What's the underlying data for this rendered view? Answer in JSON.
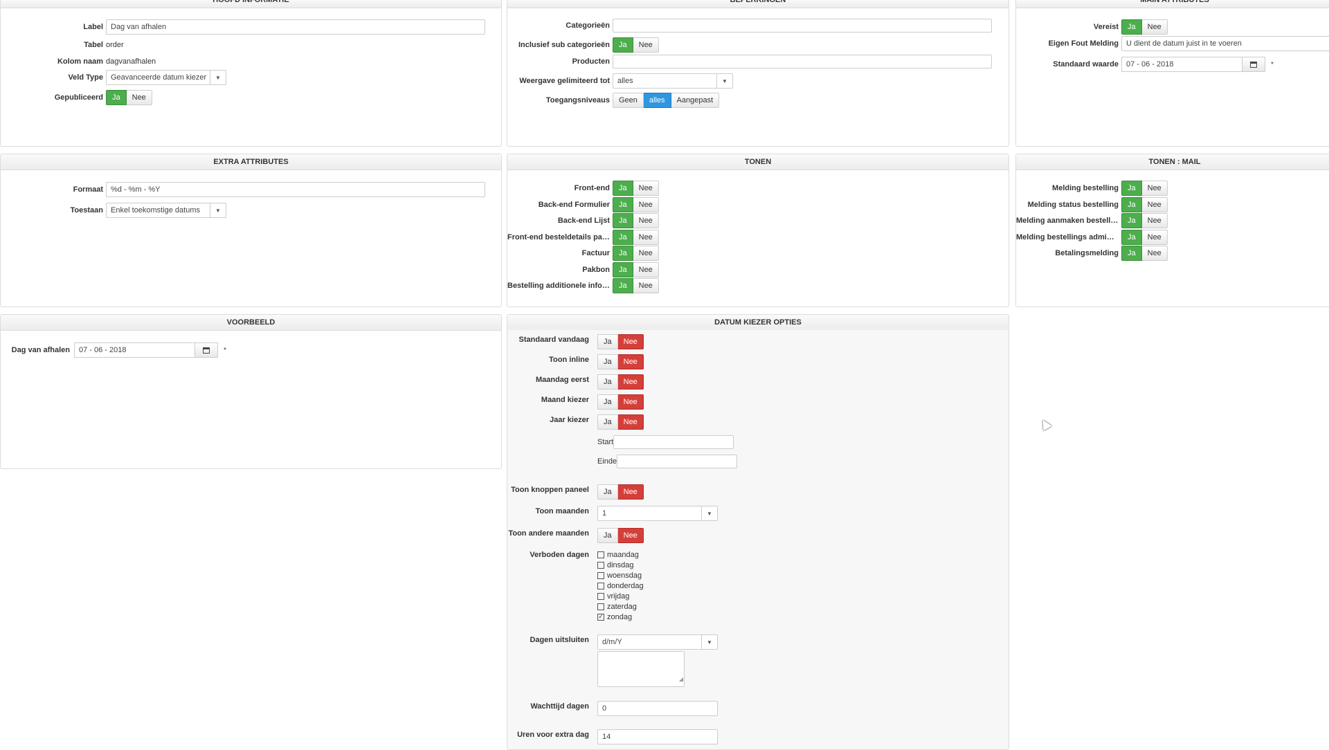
{
  "hoofd": {
    "title": "HOOFD INFORMATIE",
    "label_lbl": "Label",
    "label_val": "Dag van afhalen",
    "tabel_lbl": "Tabel",
    "tabel_val": "order",
    "kolom_lbl": "Kolom naam",
    "kolom_val": "dagvanafhalen",
    "veldtype_lbl": "Veld Type",
    "veldtype_val": "Geavanceerde datum kiezer",
    "gepubliceerd_lbl": "Gepubliceerd"
  },
  "beperkingen": {
    "title": "BEPERKINGEN",
    "categorieen_lbl": "Categorieën",
    "inclusief_lbl": "Inclusief sub categorieën",
    "producten_lbl": "Producten",
    "weergave_lbl": "Weergave gelimiteerd tot",
    "weergave_val": "alles",
    "toegang_lbl": "Toegangsniveaus",
    "toegang_opts": [
      "Geen",
      "alles",
      "Aangepast"
    ]
  },
  "main": {
    "title": "MAIN ATTRIBUTES",
    "vereist_lbl": "Vereist",
    "fout_lbl": "Eigen Fout Melding",
    "fout_val": "U dient de datum juist in te voeren",
    "standaard_lbl": "Standaard waarde",
    "standaard_val": "07 - 06 - 2018"
  },
  "extra": {
    "title": "EXTRA ATTRIBUTES",
    "formaat_lbl": "Formaat",
    "formaat_val": "%d - %m - %Y",
    "toestaan_lbl": "Toestaan",
    "toestaan_val": "Enkel toekomstige datums"
  },
  "tonen": {
    "title": "TONEN",
    "items": [
      "Front-end",
      "Back-end Formulier",
      "Back-end Lijst",
      "Front-end besteldetails pag...",
      "Factuur",
      "Pakbon",
      "Bestelling additionele infor..."
    ]
  },
  "tonen_mail": {
    "title": "TONEN : MAIL",
    "items": [
      "Melding bestelling",
      "Melding status bestelling",
      "Melding aanmaken bestelling",
      "Melding bestellings admini...",
      "Betalingsmelding"
    ]
  },
  "voorbeeld": {
    "title": "VOORBEELD",
    "dag_lbl": "Dag van afhalen",
    "dag_val": "07 - 06 - 2018"
  },
  "datum": {
    "title": "DATUM KIEZER OPTIES",
    "vandaag_lbl": "Standaard vandaag",
    "inline_lbl": "Toon inline",
    "maandag_lbl": "Maandag eerst",
    "maand_lbl": "Maand kiezer",
    "jaar_lbl": "Jaar kiezer",
    "start_lbl": "Start",
    "einde_lbl": "Einde",
    "knoppen_lbl": "Toon knoppen paneel",
    "maanden_lbl": "Toon maanden",
    "maanden_val": "1",
    "andere_lbl": "Toon andere maanden",
    "verboden_lbl": "Verboden dagen",
    "days": [
      "maandag",
      "dinsdag",
      "woensdag",
      "donderdag",
      "vrijdag",
      "zaterdag",
      "zondag"
    ],
    "checked_day": "zondag",
    "uitsluiten_lbl": "Dagen uitsluiten",
    "uitsluiten_val": "d/m/Y",
    "wachttijd_lbl": "Wachttijd dagen",
    "wachttijd_val": "0",
    "uren_lbl": "Uren voor extra dag",
    "uren_val": "14"
  },
  "common": {
    "ja": "Ja",
    "nee": "Nee",
    "star": "*"
  }
}
